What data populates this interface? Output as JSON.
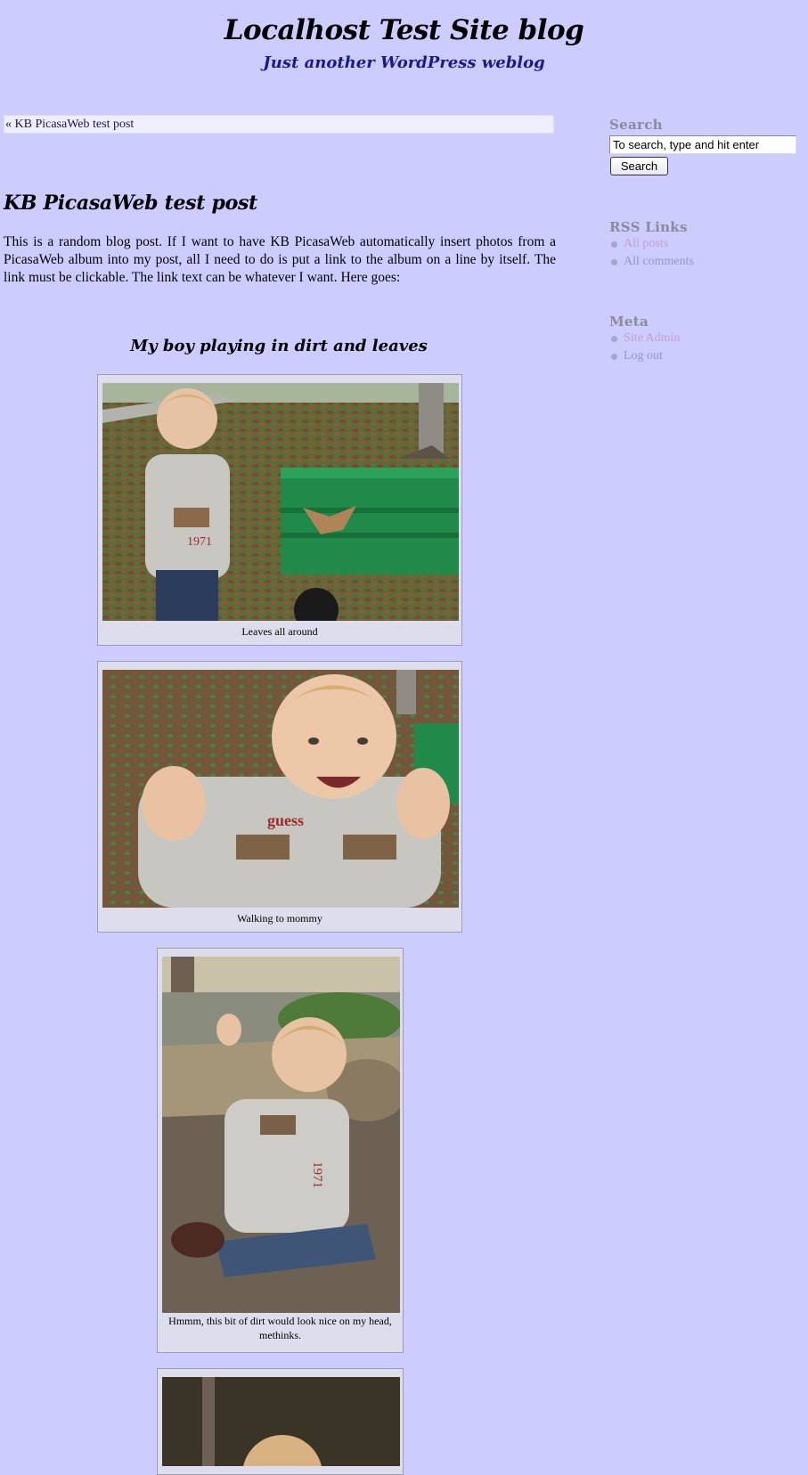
{
  "header": {
    "title": "Localhost Test Site blog",
    "tagline": "Just another WordPress weblog"
  },
  "navigation": {
    "previous_link": "« KB PicasaWeb test post"
  },
  "post": {
    "title": "KB PicasaWeb test post",
    "body": "This is a random blog post. If I want to have KB PicasaWeb automatically insert photos from a PicasaWeb album into my post, all I need to do is put a link to the album on a line by itself. The link must be clickable. The link text can be whatever I want. Here goes:",
    "album_title": "My boy playing in dirt and leaves",
    "photos": [
      {
        "caption": "Leaves all around"
      },
      {
        "caption": "Walking to mommy"
      },
      {
        "caption": "Hmmm, this bit of dirt would look nice on my head, methinks."
      },
      {
        "caption": ""
      }
    ]
  },
  "sidebar": {
    "search": {
      "heading": "Search",
      "placeholder": "To search, type and hit enter",
      "button_label": "Search"
    },
    "rss": {
      "heading": "RSS Links",
      "links": [
        "All posts",
        "All comments"
      ]
    },
    "meta": {
      "heading": "Meta",
      "links": [
        "Site Admin",
        "Log out"
      ]
    }
  },
  "colors": {
    "background": "#ccccff",
    "tagline": "#1a1a8c",
    "visited_link": "#c6a0cc",
    "link": "#9696c0",
    "sidebar_heading": "#8a8a9a"
  }
}
